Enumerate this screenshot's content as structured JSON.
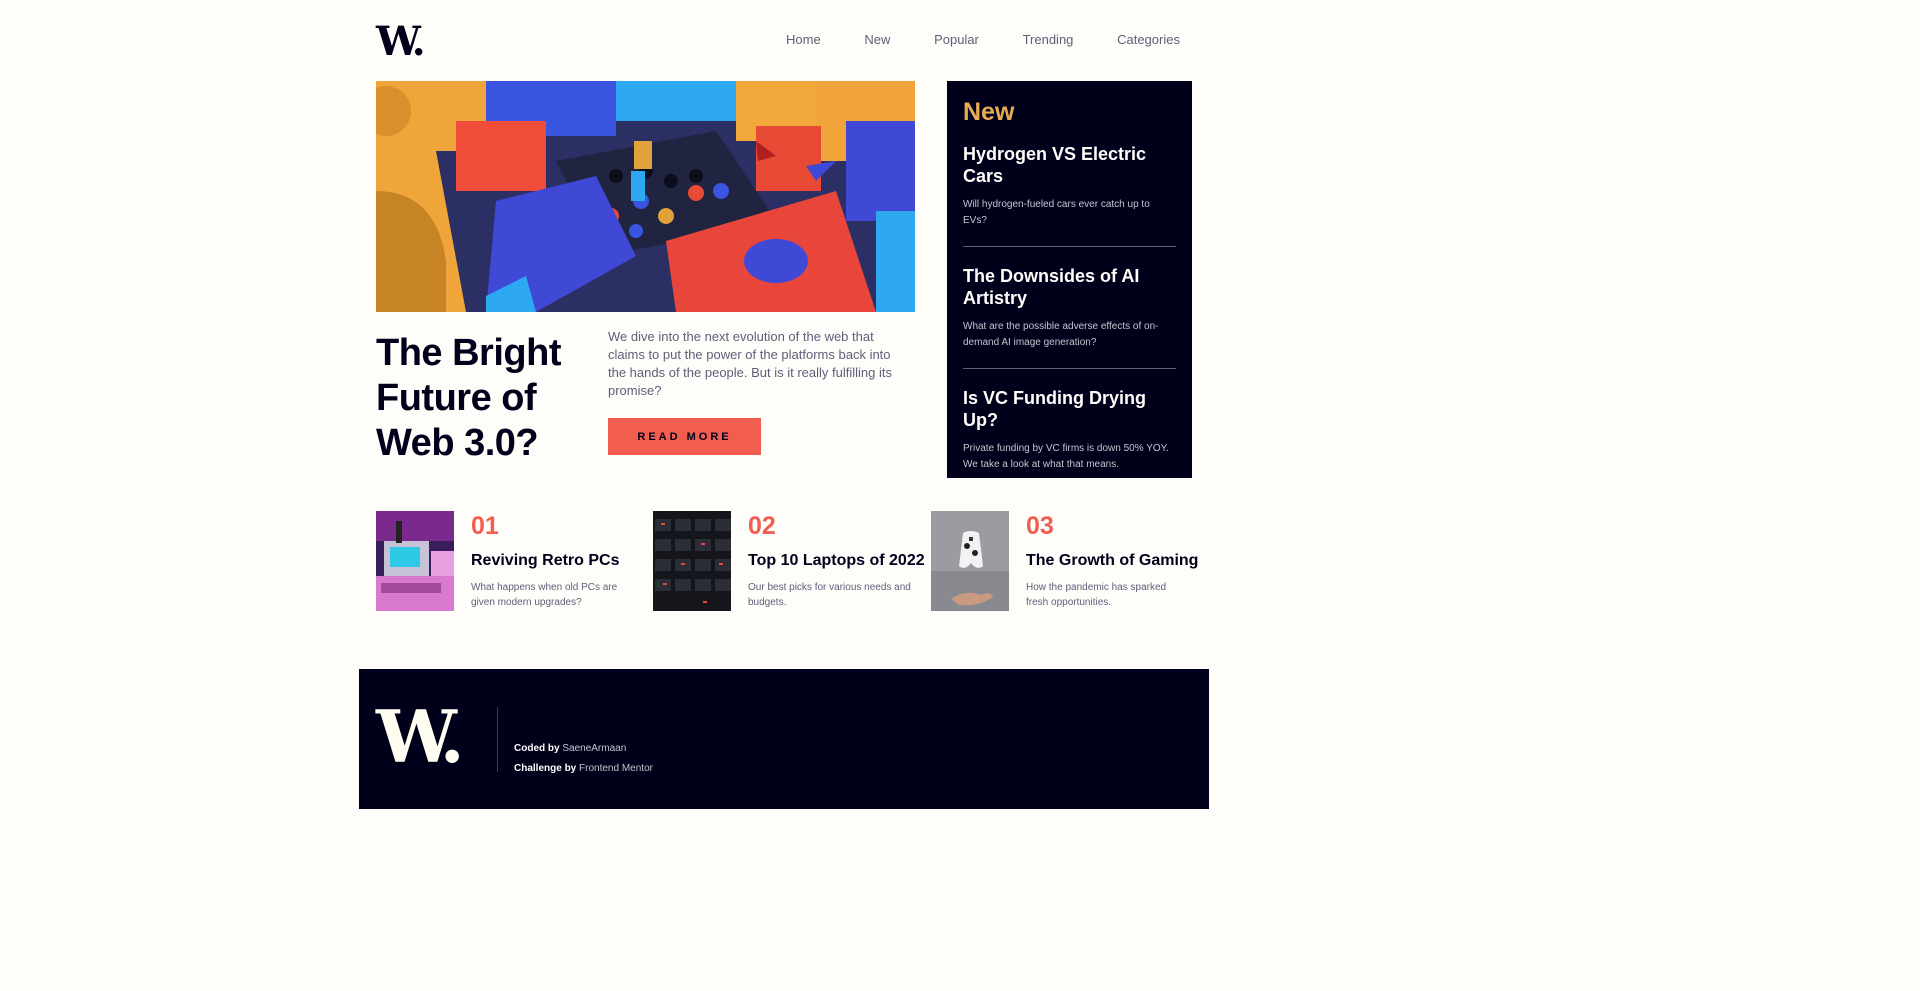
{
  "logo": {
    "letter": "W",
    "dot": "."
  },
  "nav": [
    "Home",
    "New",
    "Popular",
    "Trending",
    "Categories"
  ],
  "hero": {
    "title": "The Bright Future of Web 3.0?",
    "description": "We dive into the next evolution of the web that claims to put the power of the platforms back into the hands of the people. But is it really fulfilling its promise?",
    "button": "READ MORE"
  },
  "new_section": {
    "heading": "New",
    "items": [
      {
        "title": "Hydrogen VS Electric Cars",
        "desc": "Will hydrogen-fueled cars ever catch up to EVs?"
      },
      {
        "title": "The Downsides of AI Artistry",
        "desc": "What are the possible adverse effects of on-demand AI image generation?"
      },
      {
        "title": "Is VC Funding Drying Up?",
        "desc": "Private funding by VC firms is down 50% YOY. We take a look at what that means."
      }
    ]
  },
  "cards": [
    {
      "num": "01",
      "title": "Reviving Retro PCs",
      "desc": "What happens when old PCs are given modern upgrades?"
    },
    {
      "num": "02",
      "title": "Top 10 Laptops of 2022",
      "desc": "Our best picks for various needs and budgets."
    },
    {
      "num": "03",
      "title": "The Growth of Gaming",
      "desc": "How the pandemic has sparked fresh opportunities."
    }
  ],
  "footer": {
    "coded_label": "Coded by",
    "coded_name": "SaeneArmaan",
    "challenge_label": "Challenge by",
    "challenge_name": "Frontend Mentor"
  },
  "colors": {
    "accent": "#f15e50",
    "dark": "#00001a",
    "gold": "#e9ab53",
    "bg": "#fffdfa",
    "muted": "#5d5f79"
  }
}
